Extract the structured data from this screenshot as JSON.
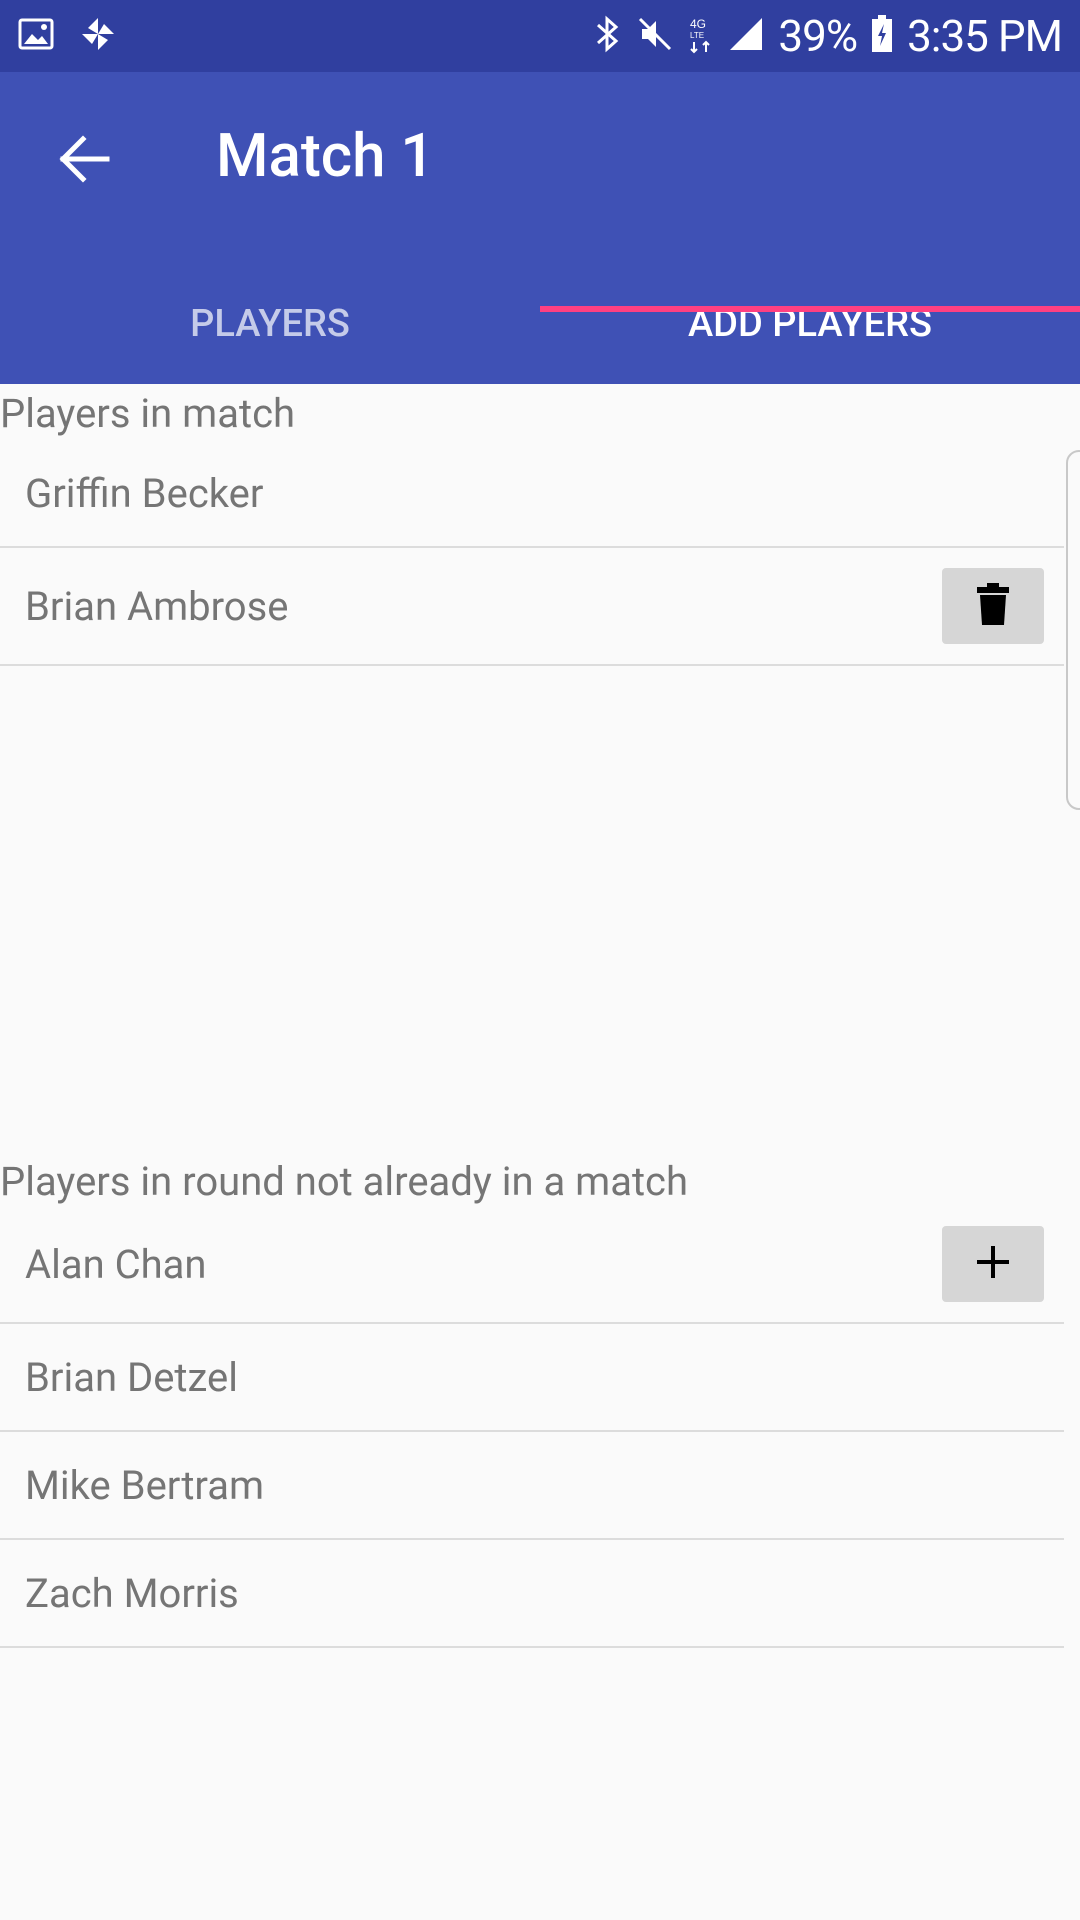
{
  "status_bar": {
    "battery": "39%",
    "time": "3:35 PM",
    "icons": [
      "image-icon",
      "pinwheel-icon",
      "bluetooth-icon",
      "mute-icon",
      "lte-icon",
      "signal-icon",
      "battery-charging-icon"
    ]
  },
  "app_bar": {
    "title": "Match 1",
    "back_icon": "arrow-back-icon"
  },
  "tabs": [
    {
      "label": "PLAYERS",
      "active": false
    },
    {
      "label": "ADD PLAYERS",
      "active": true
    }
  ],
  "colors": {
    "status_bar": "#303f9f",
    "primary": "#3f51b5",
    "accent": "#ff4081",
    "background": "#fafafa",
    "text_secondary": "#757575",
    "button_bg": "#d6d6d6"
  },
  "players_in_match": {
    "label": "Players in match",
    "players": [
      {
        "name": "Griffin Becker"
      },
      {
        "name": "Brian Ambrose",
        "action_icon": "trash-icon"
      }
    ]
  },
  "available_players": {
    "label": "Players in round not already in a match",
    "players": [
      {
        "name": "Alan Chan",
        "action_icon": "plus-icon"
      },
      {
        "name": "Brian Detzel"
      },
      {
        "name": "Mike Bertram"
      },
      {
        "name": "Zach Morris"
      }
    ]
  }
}
